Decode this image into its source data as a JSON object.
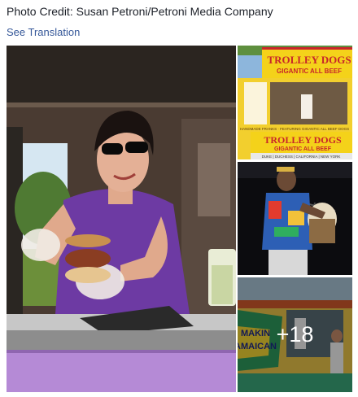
{
  "post": {
    "caption": "Photo Credit: Susan Petroni/Petroni Media Company",
    "see_translation": "See Translation"
  },
  "photos": {
    "main": {
      "subject": "woman serving pulled-pork sandwich from food truck window"
    },
    "top_right": {
      "subject": "Trolley Dogs food stand",
      "sign_text": "TROLLEY DOGS",
      "sign_subtext": "GIGANTIC ALL BEEF",
      "lower_sign_text": "TROLLEY DOGS",
      "lower_sign_subtext": "GIGANTIC ALL BEEF",
      "sign_caption": "HANDMADE FRANKS · FEATURING GIGANTIC ALL BEEF DOGS",
      "sign_strip": "DUKE | DUCHESS | CALIFORNIA | NEW YORK"
    },
    "middle_right": {
      "subject": "musician playing drum on stage"
    },
    "bottom_right": {
      "subject": "food truck painted with lettering",
      "truck_text_line1": "MAKIN",
      "truck_text_line2": "AMAICAN",
      "more_count": "+18"
    }
  },
  "colors": {
    "link": "#365899",
    "text": "#1d2129",
    "sign_yellow": "#f4d21a",
    "sign_red": "#c8262a",
    "cart_purple": "#b58ad6"
  }
}
